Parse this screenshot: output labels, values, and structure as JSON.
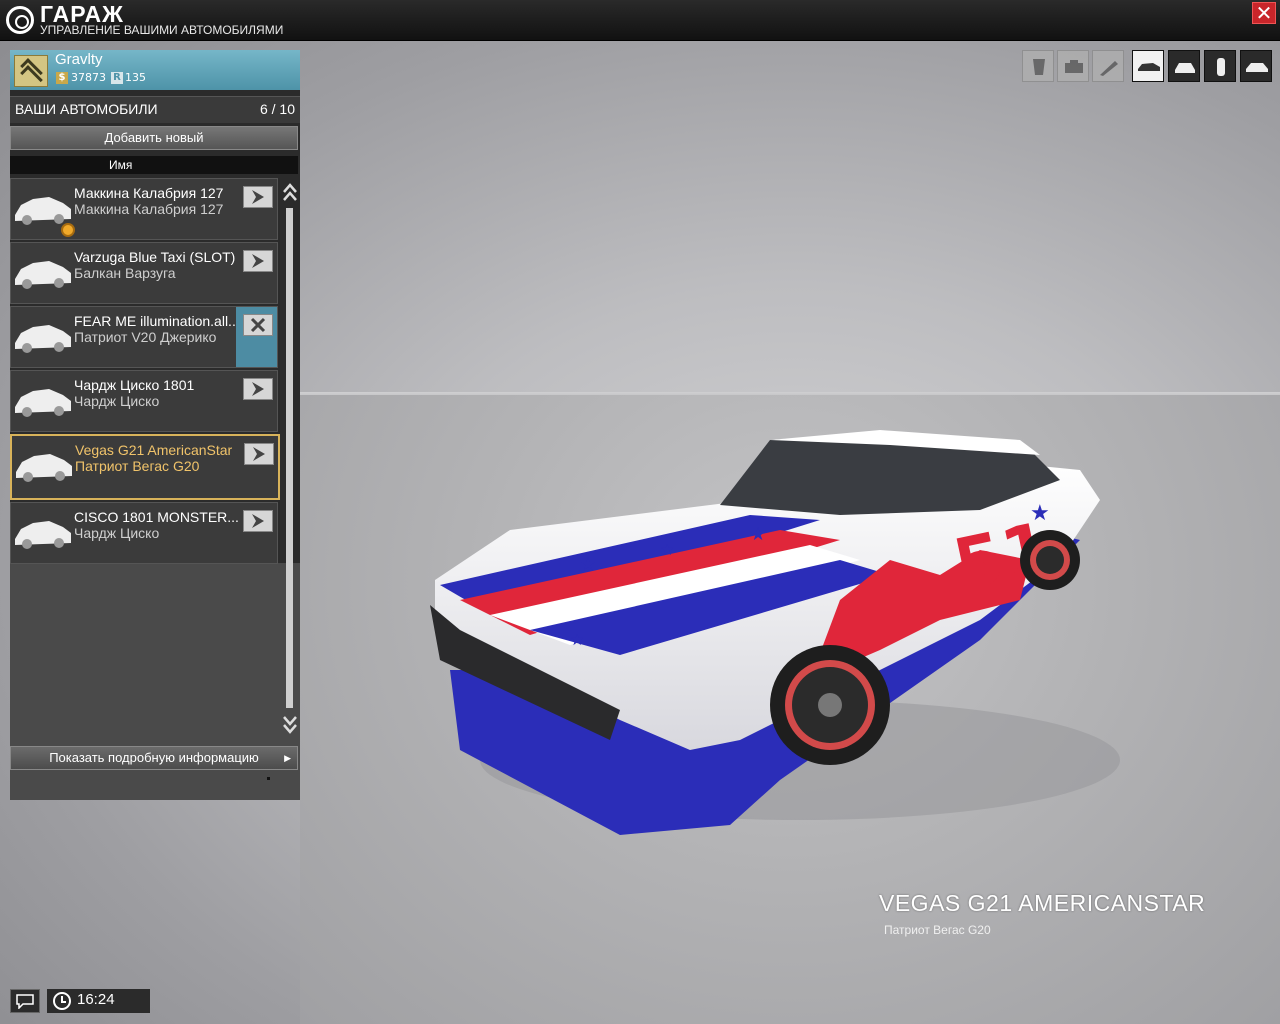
{
  "window": {
    "title": "ГАРАЖ",
    "subtitle": "УПРАВЛЕНИЕ ВАШИМИ АВТОМОБИЛЯМИ",
    "close_label": "✕"
  },
  "player": {
    "name": "Gravlty",
    "money": "37873",
    "reputation": "135",
    "money_icon": "$",
    "rep_icon": "R"
  },
  "cars_panel": {
    "header": "ВАШИ АВТОМОБИЛИ",
    "count": "6 / 10",
    "add_button": "Добавить новый",
    "column_name": "Имя",
    "details_button": "Показать подробную информацию"
  },
  "cars": [
    {
      "name": "Маккина Калабрия 127",
      "model": "Маккина Калабрия 127",
      "action_icon": "arrow-right-icon",
      "has_gear": true
    },
    {
      "name": "Varzuga Blue Taxi (SLOT)",
      "model": "Балкан Варзуга",
      "action_icon": "arrow-right-icon",
      "has_gear": false
    },
    {
      "name": "FEAR ME illumination.all...",
      "model": "Патриот V20 Джерико",
      "action_icon": "close-icon",
      "has_gear": false,
      "highlighted": true
    },
    {
      "name": "Чардж Циско 1801",
      "model": "Чардж Циско",
      "action_icon": "arrow-right-icon",
      "has_gear": false
    },
    {
      "name": "Vegas G21 AmericanStar",
      "model": "Патриот Вегас G20",
      "action_icon": "arrow-right-icon",
      "has_gear": false,
      "selected": true
    },
    {
      "name": "CISCO 1801 MONSTER...",
      "model": "Чардж Циско",
      "action_icon": "arrow-right-icon",
      "has_gear": false
    }
  ],
  "toolbar": {
    "left_group": [
      "paint-icon",
      "engine-icon",
      "horn-icon"
    ],
    "right_group": [
      "car-side-icon",
      "car-front-icon",
      "car-top-icon",
      "car-rear-icon"
    ]
  },
  "selected_car": {
    "title": "VEGAS G21 AMERICANSTAR",
    "model": "Патриот Вегас G20"
  },
  "status": {
    "time": "16:24"
  },
  "colors": {
    "accent_teal": "#4e93a8",
    "selected_gold": "#d8b35a",
    "close_red": "#c8252a"
  }
}
